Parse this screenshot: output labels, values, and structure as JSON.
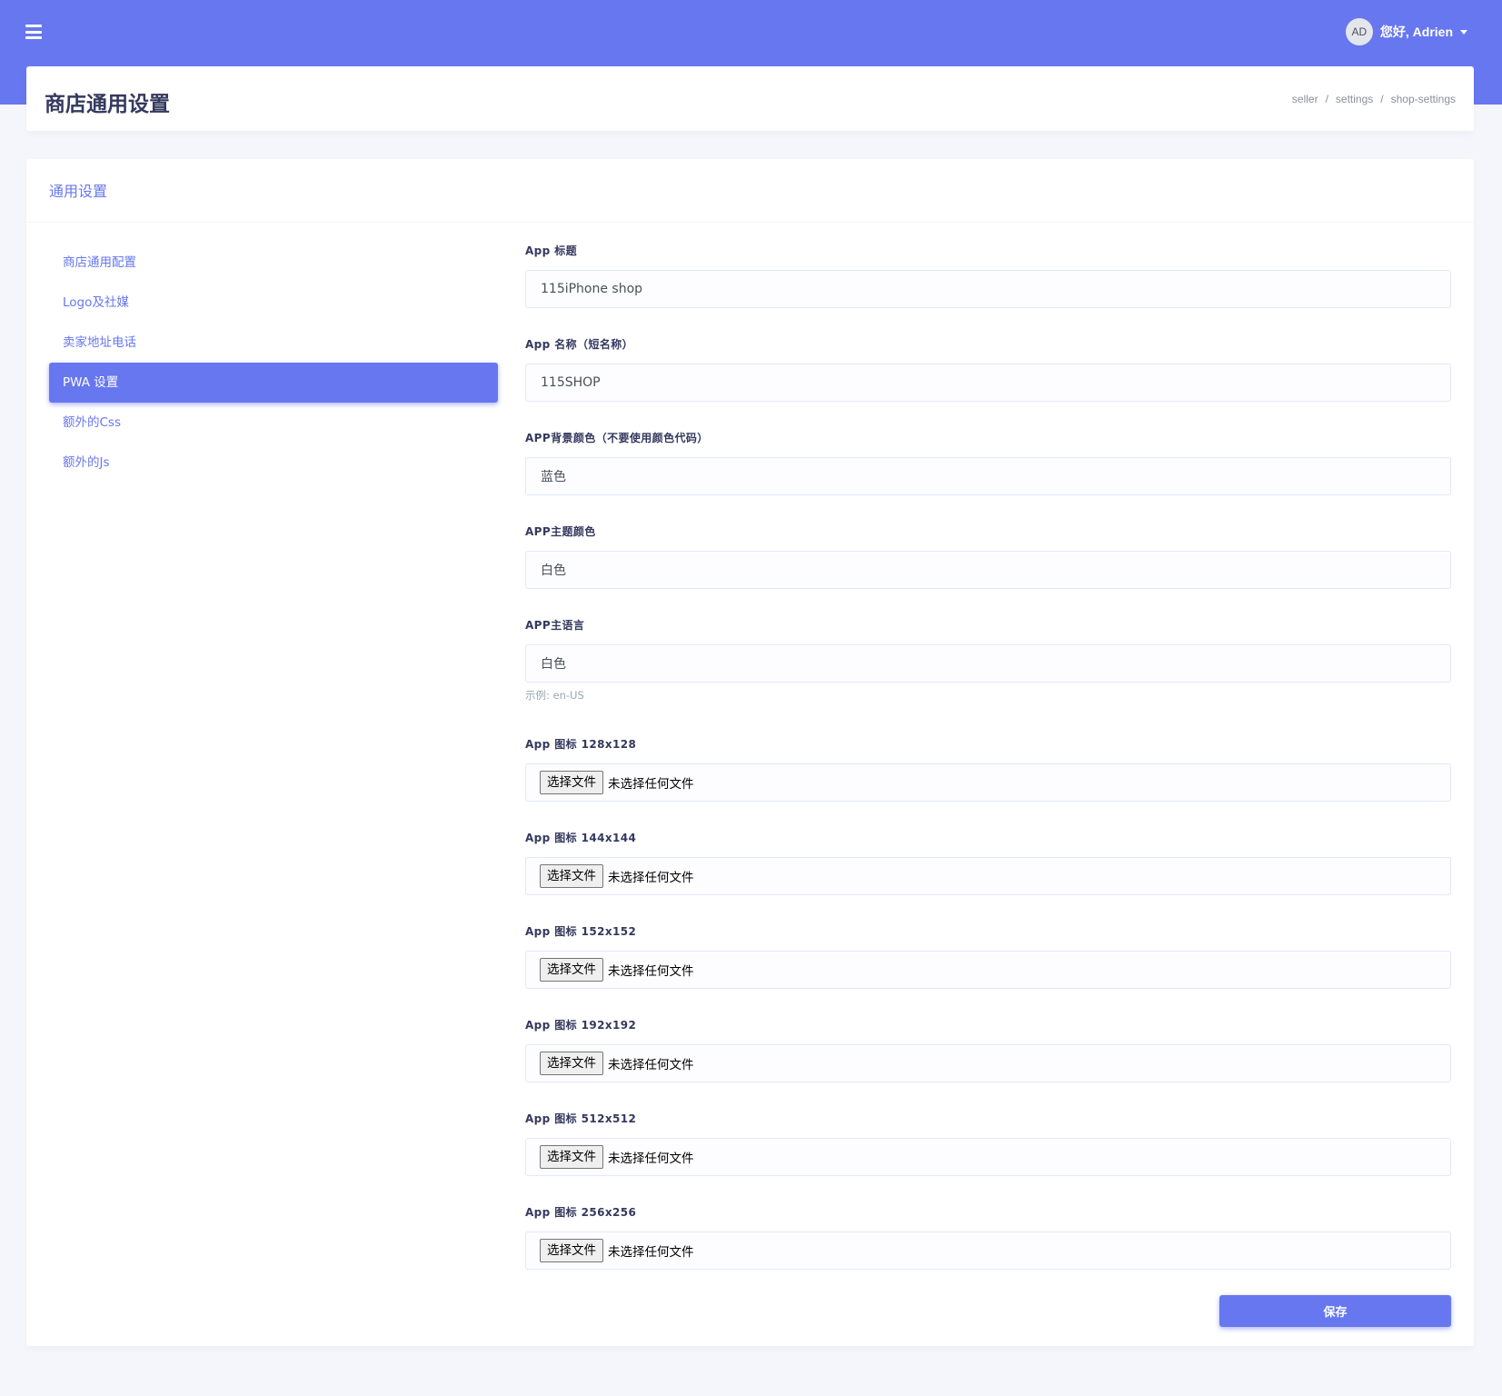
{
  "topbar": {
    "menu_icon": "hamburger-icon",
    "avatar_initials": "AD",
    "greeting": "您好, Adrien",
    "caret_icon": "caret-down-icon"
  },
  "header": {
    "title": "商店通用设置",
    "breadcrumb": [
      "seller",
      "settings",
      "shop-settings"
    ],
    "breadcrumb_sep": "/"
  },
  "card": {
    "title": "通用设置"
  },
  "sidebar": {
    "items": [
      {
        "label": "商店通用配置"
      },
      {
        "label": "Logo及社媒"
      },
      {
        "label": "卖家地址电话"
      },
      {
        "label": "PWA 设置",
        "active": true
      },
      {
        "label": "额外的Css"
      },
      {
        "label": "额外的Js"
      }
    ]
  },
  "form": {
    "app_title": {
      "label": "App 标题",
      "value": "115iPhone shop"
    },
    "app_name": {
      "label": "App 名称（短名称）",
      "value": "115SHOP"
    },
    "bg_color": {
      "label": "APP背景颜色（不要使用颜色代码）",
      "value": "蓝色"
    },
    "theme_color": {
      "label": "APP主题颜色",
      "value": "白色"
    },
    "language": {
      "label": "APP主语言",
      "value": "白色",
      "help": "示例: en-US"
    },
    "icons": [
      {
        "label": "App 图标 128x128"
      },
      {
        "label": "App 图标 144x144"
      },
      {
        "label": "App 图标 152x152"
      },
      {
        "label": "App 图标 192x192"
      },
      {
        "label": "App 图标 512x512"
      },
      {
        "label": "App 图标 256x256"
      }
    ],
    "file_button_label": "选择文件",
    "file_status": "未选择任何文件",
    "save_label": "保存"
  },
  "colors": {
    "primary": "#6777ef",
    "page_bg": "#f5f6fb",
    "title": "#34395e"
  }
}
